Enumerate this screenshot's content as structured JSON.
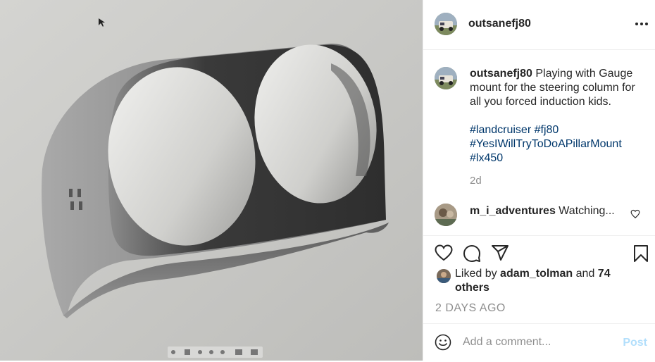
{
  "post": {
    "image_alt": "CAD render of a dual gauge pod mount"
  },
  "header": {
    "username": "outsanefj80",
    "more_icon": "more-horizontal-icon"
  },
  "caption": {
    "username": "outsanefj80",
    "text": "Playing with Gauge mount for the steering column for all you forced induction kids.",
    "hashtags": [
      "#landcruiser",
      "#fj80",
      "#YesIWillTryToDoAPillarMount",
      "#lx450"
    ],
    "time": "2d"
  },
  "comments": [
    {
      "username": "m_i_adventures",
      "text": "Watching..."
    }
  ],
  "actions": {
    "like_icon": "heart-icon",
    "comment_icon": "comment-icon",
    "share_icon": "send-icon",
    "save_icon": "bookmark-icon"
  },
  "likes": {
    "prefix": "Liked by",
    "user": "adam_tolman",
    "joiner": "and",
    "others": "74 others"
  },
  "date": "2 DAYS AGO",
  "add_comment": {
    "placeholder": "Add a comment...",
    "post_label": "Post",
    "emoji_icon": "emoji-icon"
  },
  "colors": {
    "link": "#00376b",
    "muted": "#8e8e8e",
    "post_disabled": "#b2dffc",
    "text": "#262626"
  }
}
